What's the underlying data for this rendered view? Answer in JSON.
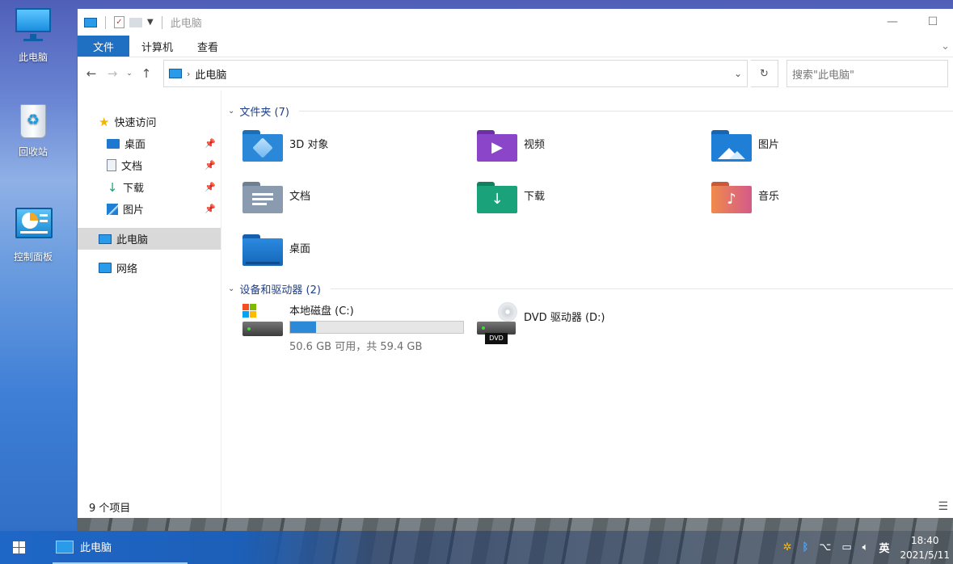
{
  "desktop": {
    "icons": [
      {
        "label": "此电脑",
        "icon": "computer-icon"
      },
      {
        "label": "回收站",
        "icon": "recycle-bin-icon"
      },
      {
        "label": "控制面板",
        "icon": "control-panel-icon"
      }
    ]
  },
  "window": {
    "title": "此电脑",
    "ribbon_tabs": [
      "文件",
      "计算机",
      "查看"
    ],
    "address": {
      "path_label": "此电脑",
      "search_placeholder": "搜索\"此电脑\""
    }
  },
  "nav": {
    "quick_access": "快速访问",
    "pinned": [
      {
        "label": "桌面",
        "icon": "desktop-icon"
      },
      {
        "label": "文档",
        "icon": "document-icon"
      },
      {
        "label": "下载",
        "icon": "download-icon"
      },
      {
        "label": "图片",
        "icon": "pictures-icon"
      }
    ],
    "this_pc": "此电脑",
    "network": "网络"
  },
  "main": {
    "folders_header": "文件夹 (7)",
    "folders": [
      {
        "label": "3D 对象",
        "icon": "3d-objects-icon",
        "color": "#2b88d8"
      },
      {
        "label": "视频",
        "icon": "video-icon",
        "color": "#8b45c9"
      },
      {
        "label": "图片",
        "icon": "picture-icon",
        "color": "#1f7fd6"
      },
      {
        "label": "文档",
        "icon": "document-folder-icon",
        "color": "#8a9bb0"
      },
      {
        "label": "下载",
        "icon": "download-folder-icon",
        "color": "#1aa37a"
      },
      {
        "label": "音乐",
        "icon": "music-icon",
        "color": "#e8734e"
      },
      {
        "label": "桌面",
        "icon": "desktop-folder-icon",
        "color": "#1f78d0"
      }
    ],
    "devices_header": "设备和驱动器 (2)",
    "drives": [
      {
        "label": "本地磁盘 (C:)",
        "usage_text": "50.6 GB 可用，共 59.4 GB",
        "used_fraction": 0.148
      },
      {
        "label": "DVD 驱动器 (D:)",
        "badge": "DVD"
      }
    ]
  },
  "status": {
    "count": "9 个项目"
  },
  "taskbar": {
    "app_label": "此电脑",
    "ime": "英",
    "time": "18:40",
    "date": "2021/5/11"
  }
}
